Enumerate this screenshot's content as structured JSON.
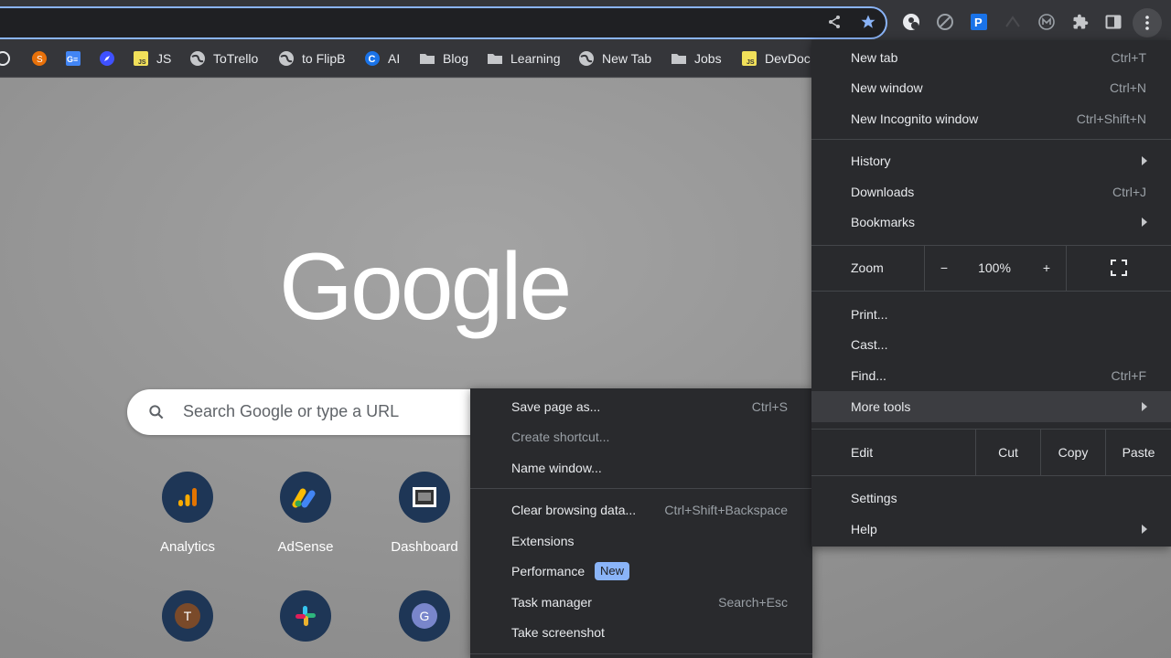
{
  "colors": {
    "accent": "#8ab4f8",
    "menu_bg": "#292a2d",
    "toolbar_bg": "#35363a",
    "tile_bg": "#1e3656"
  },
  "bookmarks": [
    {
      "label": "",
      "icon": "github-icon"
    },
    {
      "label": "",
      "icon": "orange-extension-icon"
    },
    {
      "label": "",
      "icon": "google-sheets-icon"
    },
    {
      "label": "",
      "icon": "compass-icon"
    },
    {
      "label": "JS",
      "icon": "js-icon"
    },
    {
      "label": "ToTrello",
      "icon": "globe-icon"
    },
    {
      "label": "to FlipB",
      "icon": "globe-icon"
    },
    {
      "label": "AI",
      "icon": "c-logo-icon"
    },
    {
      "label": "Blog",
      "icon": "folder-icon"
    },
    {
      "label": "Learning",
      "icon": "folder-icon"
    },
    {
      "label": "New Tab",
      "icon": "globe-icon"
    },
    {
      "label": "Jobs",
      "icon": "folder-icon"
    },
    {
      "label": "DevDoc",
      "icon": "js-icon"
    }
  ],
  "search": {
    "placeholder": "Search Google or type a URL"
  },
  "logo_text": "Google",
  "shortcuts": [
    {
      "label": "Analytics",
      "icon": "analytics-icon"
    },
    {
      "label": "AdSense",
      "icon": "adsense-icon"
    },
    {
      "label": "Dashboard",
      "icon": "dashboard-icon"
    },
    {
      "label": "",
      "initial": "T"
    },
    {
      "label": "",
      "icon": "slack-icon"
    },
    {
      "label": "",
      "initial": "G"
    }
  ],
  "main_menu": {
    "new_tab": {
      "label": "New tab",
      "shortcut": "Ctrl+T"
    },
    "new_window": {
      "label": "New window",
      "shortcut": "Ctrl+N"
    },
    "new_incognito": {
      "label": "New Incognito window",
      "shortcut": "Ctrl+Shift+N"
    },
    "history": {
      "label": "History"
    },
    "downloads": {
      "label": "Downloads",
      "shortcut": "Ctrl+J"
    },
    "bookmarks": {
      "label": "Bookmarks"
    },
    "zoom": {
      "label": "Zoom",
      "minus": "−",
      "value": "100%",
      "plus": "+"
    },
    "print": {
      "label": "Print..."
    },
    "cast": {
      "label": "Cast..."
    },
    "find": {
      "label": "Find...",
      "shortcut": "Ctrl+F"
    },
    "more_tools": {
      "label": "More tools"
    },
    "edit": {
      "label": "Edit",
      "cut": "Cut",
      "copy": "Copy",
      "paste": "Paste"
    },
    "settings": {
      "label": "Settings"
    },
    "help": {
      "label": "Help"
    }
  },
  "more_tools_menu": {
    "save_page": {
      "label": "Save page as...",
      "shortcut": "Ctrl+S"
    },
    "create_shortcut": {
      "label": "Create shortcut..."
    },
    "name_window": {
      "label": "Name window..."
    },
    "clear_data": {
      "label": "Clear browsing data...",
      "shortcut": "Ctrl+Shift+Backspace"
    },
    "extensions": {
      "label": "Extensions"
    },
    "performance": {
      "label": "Performance",
      "badge": "New"
    },
    "task_manager": {
      "label": "Task manager",
      "shortcut": "Search+Esc"
    },
    "screenshot": {
      "label": "Take screenshot"
    }
  }
}
